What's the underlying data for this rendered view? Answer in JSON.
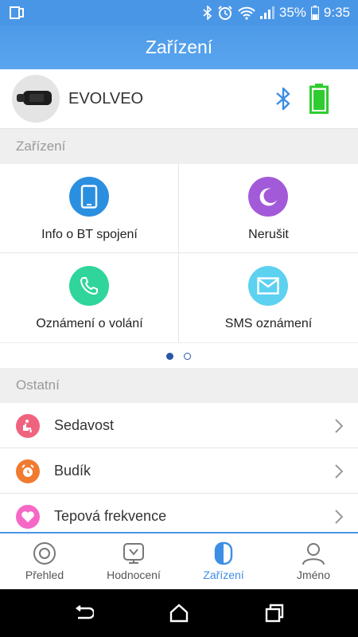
{
  "status_bar": {
    "battery_percent": "35%",
    "time": "9:35",
    "icons": [
      "screen-icon",
      "bluetooth-icon",
      "alarm-icon",
      "wifi-icon",
      "signal-icon",
      "battery-icon"
    ]
  },
  "header": {
    "title": "Zařízení"
  },
  "device": {
    "name": "EVOLVEO",
    "bluetooth_color": "#3d8ee4",
    "battery_color": "#2ecc2e"
  },
  "sections": {
    "devices_title": "Zařízení",
    "other_title": "Ostatní"
  },
  "grid": [
    {
      "label": "Info o BT spojení",
      "icon": "phone-icon",
      "color": "#2b8fe0"
    },
    {
      "label": "Nerušit",
      "icon": "moon-icon",
      "color": "#a35ad9"
    },
    {
      "label": "Oznámení o volání",
      "icon": "call-icon",
      "color": "#2fd59b"
    },
    {
      "label": "SMS oznámení",
      "icon": "envelope-icon",
      "color": "#5dd1f0"
    }
  ],
  "pager": {
    "pages": 2,
    "current": 1
  },
  "other_list": [
    {
      "label": "Sedavost",
      "icon": "seat-icon",
      "color": "#f0637f"
    },
    {
      "label": "Budík",
      "icon": "alarm-clock-icon",
      "color": "#f07a30"
    },
    {
      "label": "Tepová frekvence",
      "icon": "heart-icon",
      "color": "#f568c6"
    }
  ],
  "bottom_nav": [
    {
      "label": "Přehled",
      "icon": "overview-icon",
      "active": false
    },
    {
      "label": "Hodnocení",
      "icon": "rating-icon",
      "active": false
    },
    {
      "label": "Zařízení",
      "icon": "device-icon",
      "active": true
    },
    {
      "label": "Jméno",
      "icon": "profile-icon",
      "active": false
    }
  ],
  "colors": {
    "accent": "#4a96e6",
    "active_nav": "#3d8ee4"
  }
}
